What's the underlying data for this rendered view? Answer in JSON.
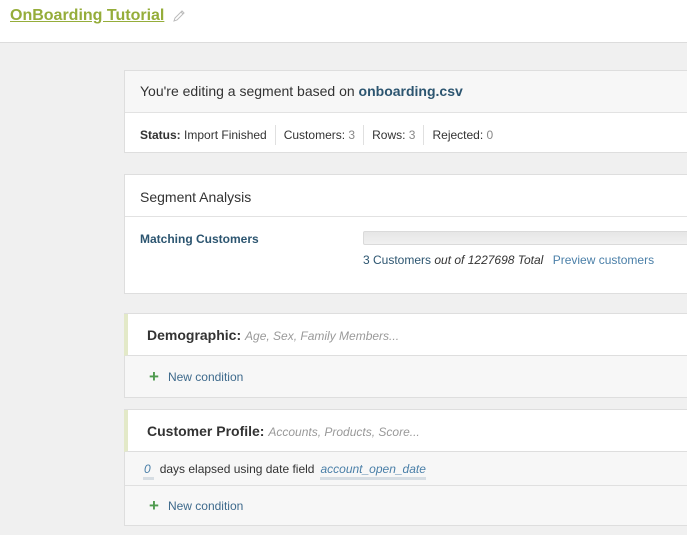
{
  "header": {
    "title": "OnBoarding Tutorial",
    "edit_icon": "pencil-icon"
  },
  "info": {
    "prefix": "You're editing a segment based on ",
    "file": "onboarding.csv",
    "stats": [
      {
        "key": "Status:",
        "value": "Import Finished"
      },
      {
        "key": "Customers:",
        "value": "3"
      },
      {
        "key": "Rows:",
        "value": "3"
      },
      {
        "key": "Rejected:",
        "value": "0"
      }
    ]
  },
  "analysis": {
    "title": "Segment Analysis",
    "label": "Matching Customers",
    "progress_fraction": 2.4e-06,
    "count_text": "3 Customers",
    "of_text": " out of 1227698 Total",
    "preview_link": "Preview customers"
  },
  "demographic": {
    "title": "Demographic:",
    "hint": "Age, Sex, Family Members...",
    "new_condition": "New condition",
    "add_icon": "plus-icon"
  },
  "profile": {
    "title": "Customer Profile:",
    "hint": "Accounts, Products, Score...",
    "rule": {
      "days_value": "0",
      "middle_text": "days elapsed using date field",
      "field_value": "account_open_date"
    },
    "new_condition": "New condition",
    "add_icon": "plus-icon"
  },
  "colors": {
    "brand": "#95ad3a",
    "link": "#2c5570",
    "add": "#4e9a4e"
  }
}
